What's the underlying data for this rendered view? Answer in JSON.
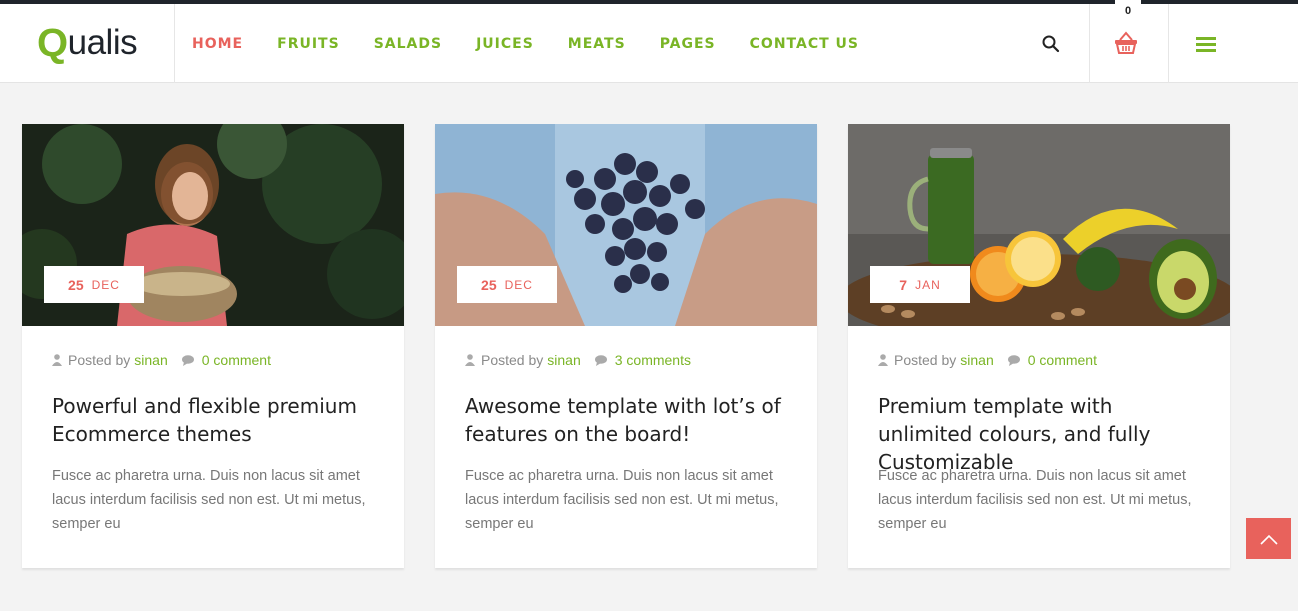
{
  "brand": {
    "q": "Q",
    "rest": "ualis"
  },
  "nav": [
    {
      "label": "HOME",
      "active": true
    },
    {
      "label": "FRUITS"
    },
    {
      "label": "SALADS"
    },
    {
      "label": "JUICES"
    },
    {
      "label": "MEATS"
    },
    {
      "label": "PAGES"
    },
    {
      "label": "CONTACT US"
    }
  ],
  "cart": {
    "count": "0"
  },
  "colors": {
    "accent": "#7ab526",
    "highlight": "#e8625c",
    "dark": "#1f242b"
  },
  "posts": [
    {
      "image": "woman-picking-vegetables-photo",
      "day": "25",
      "month": "DEC",
      "posted_by": "Posted by",
      "author": "sinan",
      "comments": "0 comment",
      "title": "Powerful and flexible premium Ecommerce themes",
      "excerpt": "Fusce ac pharetra urna. Duis non lacus sit amet lacus interdum facilisis sed non est. Ut mi metus, semper eu"
    },
    {
      "image": "hands-holding-grapes-photo",
      "day": "25",
      "month": "DEC",
      "posted_by": "Posted by",
      "author": "sinan",
      "comments": "3 comments",
      "title": "Awesome template with lot’s of features on the board!",
      "excerpt": "Fusce ac pharetra urna. Duis non lacus sit amet lacus interdum facilisis sed non est. Ut mi metus, semper eu"
    },
    {
      "image": "juice-and-fruits-photo",
      "day": "7",
      "month": "JAN",
      "posted_by": "Posted by",
      "author": "sinan",
      "comments": "0 comment",
      "title": "Premium template with unlimited colours, and fully Customizable",
      "excerpt": "Fusce ac pharetra urna. Duis non lacus sit amet lacus interdum facilisis sed non est. Ut mi metus, semper eu"
    }
  ]
}
